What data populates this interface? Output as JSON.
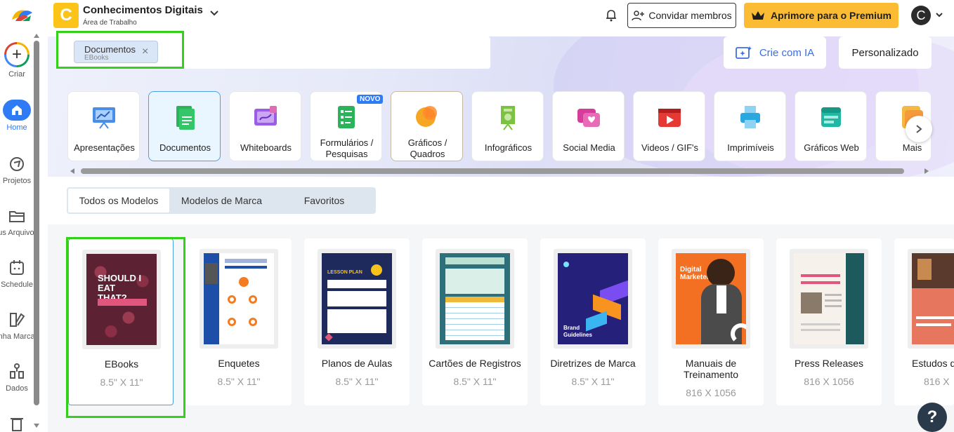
{
  "sidebar": {
    "items": [
      {
        "label": "Criar",
        "icon": "plus-icon"
      },
      {
        "label": "Home",
        "icon": "home-icon"
      },
      {
        "label": "Projetos",
        "icon": "projects-icon"
      },
      {
        "label": "Meus Arquivos",
        "icon": "folder-icon"
      },
      {
        "label": "Schedule",
        "icon": "calendar-icon"
      },
      {
        "label": "Minha Marca",
        "icon": "brand-icon"
      },
      {
        "label": "Dados",
        "icon": "data-icon"
      }
    ]
  },
  "header": {
    "workspace_initial": "C",
    "workspace_name": "Conhecimentos Digitais",
    "workspace_sub": "Área de Trabalho",
    "invite_label": "Convidar membros",
    "premium_label": "Aprimore para o Premium",
    "avatar_initial": "C"
  },
  "search": {
    "chip_label": "Documentos",
    "chip_sub": "EBooks"
  },
  "banner": {
    "ai_label": "Crie com IA",
    "custom_label": "Personalizado"
  },
  "categories": [
    {
      "label": "Apresentações"
    },
    {
      "label": "Documentos"
    },
    {
      "label": "Whiteboards"
    },
    {
      "label": "Formulários / Pesquisas",
      "badge": "NOVO"
    },
    {
      "label": "Gráficos / Quadros"
    },
    {
      "label": "Infográficos"
    },
    {
      "label": "Social Media"
    },
    {
      "label": "Videos / GIF's"
    },
    {
      "label": "Imprimíveis"
    },
    {
      "label": "Gráficos Web"
    },
    {
      "label": "Mais"
    }
  ],
  "tabs": [
    "Todos os Modelos",
    "Modelos de Marca",
    "Favoritos"
  ],
  "templates": [
    {
      "name": "EBooks",
      "size": "8.5\" X 11\"",
      "thumb_text": "SHOULD I EAT THAT?"
    },
    {
      "name": "Enquetes",
      "size": "8.5\" X 11\""
    },
    {
      "name": "Planos de Aulas",
      "size": "8.5\" X 11\"",
      "thumb_text": "LESSON PLAN"
    },
    {
      "name": "Cartões de Registros",
      "size": "8.5\" X 11\""
    },
    {
      "name": "Diretrizes de Marca",
      "size": "8.5\" X 11\"",
      "thumb_text": "Brand Guidelines"
    },
    {
      "name": "Manuais de Treinamento",
      "size": "816 X 1056",
      "thumb_text": "Digital Marketer"
    },
    {
      "name": "Press Releases",
      "size": "816 X 1056"
    },
    {
      "name": "Estudos de",
      "size": "816 X"
    }
  ],
  "help_label": "?",
  "colors": {
    "accent_blue": "#2f7bf6",
    "premium_yellow": "#fbbc33",
    "highlight_green": "#34d11a"
  }
}
